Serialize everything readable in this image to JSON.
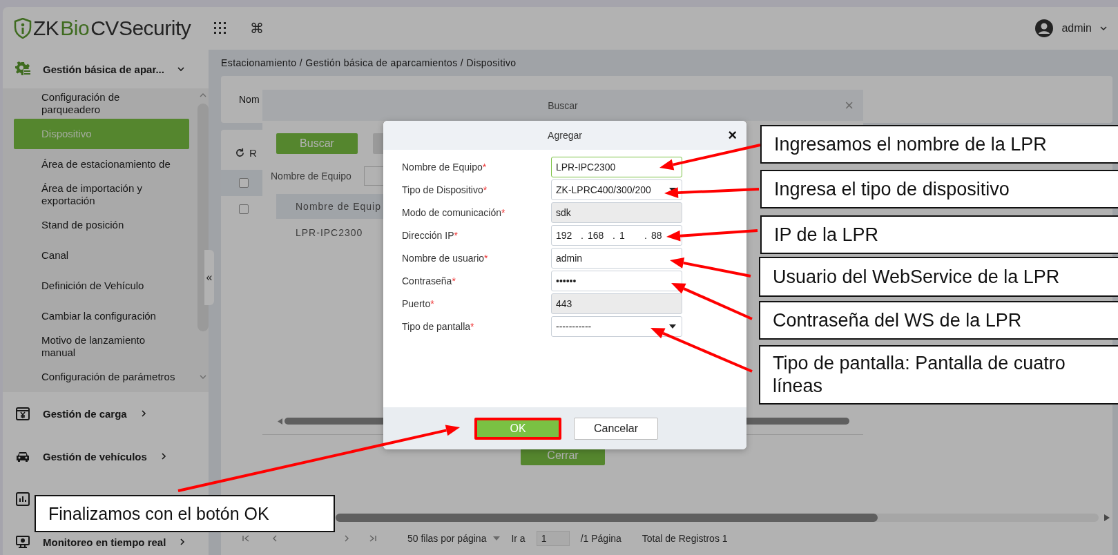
{
  "header": {
    "logo": [
      {
        "text": "ZK",
        "accent": false
      },
      {
        "text": "Bio",
        "accent": true
      },
      {
        "text": " CVSecurity",
        "accent": false
      }
    ],
    "launcher_glyph": "⌘",
    "user": "admin"
  },
  "sidebar": {
    "collapse_glyph": "«",
    "groups": [
      {
        "kind": "gear",
        "label": "Gestión básica de apar...",
        "expanded": true,
        "children": [
          {
            "label": "Configuración de parqueadero",
            "selected": false
          },
          {
            "label": "Dispositivo",
            "selected": true
          },
          {
            "label": "Área de estacionamiento de",
            "selected": false
          },
          {
            "label": "Área de importación y exportación",
            "selected": false
          },
          {
            "label": "Stand de posición",
            "selected": false
          },
          {
            "label": "Canal",
            "selected": false
          },
          {
            "label": "Definición de Vehículo",
            "selected": false
          },
          {
            "label": "Cambiar la configuración",
            "selected": false
          },
          {
            "label": "Motivo de lanzamiento manual",
            "selected": false
          },
          {
            "label": "Configuración de parámetros",
            "selected": false
          }
        ]
      },
      {
        "kind": "cargo",
        "label": "Gestión de carga",
        "expanded": false
      },
      {
        "kind": "car",
        "label": "Gestión de vehículos",
        "expanded": false
      },
      {
        "kind": "chart"
      },
      {
        "kind": "monitor",
        "label": "Monitoreo en tiempo real",
        "expanded": false
      }
    ]
  },
  "page": {
    "breadcrumb": "Estacionamiento / Gestión básica de aparcamientos / Dispositivo",
    "filter_label": "Nom",
    "refresh_label": "R",
    "checkboxes": [
      {
        "checked": false
      },
      {
        "checked": false
      }
    ],
    "pagination": {
      "page_size": "50 filas por página",
      "goto_label": "Ir a",
      "page": "1",
      "pages": "/1 Página",
      "total": "Total de Registros 1"
    }
  },
  "search_dialog": {
    "title": "Buscar",
    "close_glyph": "×",
    "search_button": "Buscar",
    "filter_label": "Nombre de Equipo",
    "columns": [
      "Nombre de Equip"
    ],
    "rows": [
      [
        "LPR-IPC2300"
      ]
    ],
    "close_button": "Cerrar"
  },
  "dialog": {
    "title": "Agregar",
    "close_glyph": "×",
    "fields": [
      {
        "kind": "text",
        "label": "Nombre de Equipo",
        "mark": "*",
        "value": "LPR-IPC2300",
        "focused": true
      },
      {
        "kind": "select",
        "label": "Tipo de Dispositivo",
        "mark": "*",
        "value": "ZK-LPRC400/300/200",
        "focused": false
      },
      {
        "kind": "readonly",
        "label": "Modo de comunicación",
        "mark": "*",
        "value": "sdk",
        "focused": false
      },
      {
        "kind": "ip",
        "label": "Dirección IP",
        "mark": "*",
        "octets": [
          "192",
          "168",
          "1",
          "88"
        ],
        "separator": ".",
        "focused": false
      },
      {
        "kind": "text",
        "label": "Nombre de usuario",
        "mark": "*",
        "value": "admin",
        "focused": false
      },
      {
        "kind": "password",
        "label": "Contraseña",
        "mark": "*",
        "value": "••••••",
        "focused": false
      },
      {
        "kind": "readonly",
        "label": "Puerto",
        "mark": "*",
        "value": "443",
        "focused": false
      },
      {
        "kind": "select",
        "label": "Tipo de pantalla",
        "mark": "*",
        "value": "-----------",
        "focused": false
      }
    ],
    "buttons": [
      {
        "label": "OK",
        "kind": "primary",
        "highlighted": true
      },
      {
        "label": "Cancelar",
        "kind": "secondary",
        "highlighted": false
      }
    ]
  },
  "annotations": [
    {
      "text": "Ingresamos el nombre de la LPR"
    },
    {
      "text": "Ingresa el tipo de dispositivo"
    },
    {
      "text": "IP de la LPR"
    },
    {
      "text": "Usuario del WebService de la LPR"
    },
    {
      "text": "Contraseña del WS de la LPR"
    },
    {
      "text": "Tipo de pantalla: Pantalla de cuatro líneas"
    },
    {
      "text": "Finalizamos con el botón OK"
    }
  ]
}
